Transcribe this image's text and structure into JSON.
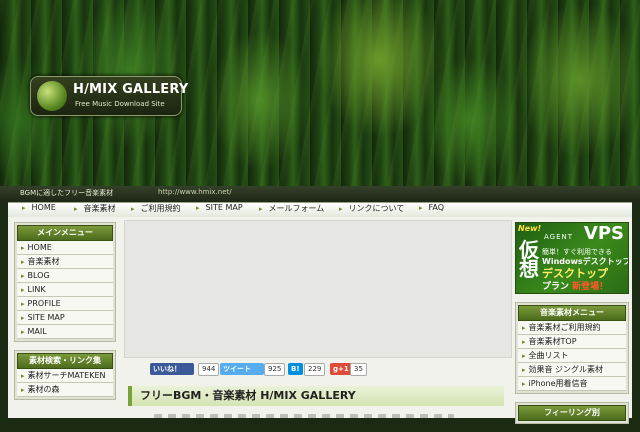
{
  "header": {
    "logo_title": "H/MIX GALLERY",
    "logo_subtitle": "Free Music Download Site",
    "tagline": "BGMに適したフリー音楽素材",
    "url": "http://www.hmix.net/"
  },
  "nav": {
    "items": [
      "HOME",
      "音楽素材",
      "ご利用規約",
      "SITE MAP",
      "メールフォーム",
      "リンクについて",
      "FAQ"
    ]
  },
  "sidebar_left": {
    "main_menu": {
      "title": "メインメニュー",
      "items": [
        "HOME",
        "音楽素材",
        "BLOG",
        "LINK",
        "PROFILE",
        "SITE MAP",
        "MAIL"
      ]
    },
    "search_links": {
      "title": "素材検索・リンク集",
      "items": [
        "素材サーチMATEKEN",
        "素材の森"
      ]
    }
  },
  "social": {
    "like_label": "いいね！",
    "like_count": "944",
    "tweet_label": "ツイート",
    "tweet_count": "925",
    "hatena_label": "B!",
    "hatena_count": "229",
    "gplus_label": "g+1",
    "gplus_count": "35"
  },
  "main": {
    "title": "フリーBGM・音楽素材 H/MIX GALLERY"
  },
  "sidebar_right": {
    "banner": {
      "new_label": "New!",
      "brand": "AGENT",
      "product": "VPS",
      "big": "仮想",
      "line1": "簡単！すぐ利用できる",
      "line2": "Windowsデスクトップ",
      "line3": "デスクトップ",
      "line4_a": "プラン ",
      "line4_b": "新登場！"
    },
    "music_menu": {
      "title": "音楽素材メニュー",
      "items": [
        "音楽素材ご利用規約",
        "音楽素材TOP",
        "全曲リスト",
        "効果音 ジングル素材",
        "iPhone用着信音"
      ]
    },
    "feeling": {
      "title": "フィーリング別"
    }
  },
  "colors": {
    "accent": "#6b8a30",
    "menu_header": "#5c7a26",
    "facebook": "#3b5998",
    "twitter": "#55acee",
    "hatena": "#008fde",
    "gplus": "#dd4b39"
  }
}
